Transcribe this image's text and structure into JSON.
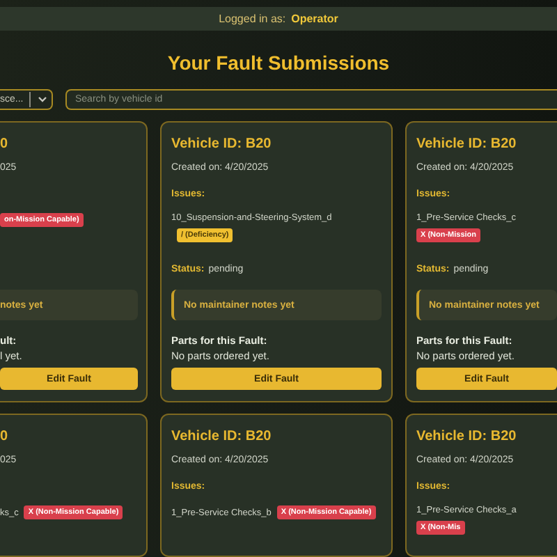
{
  "header": {
    "label": "Logged in as:",
    "user": "Operator"
  },
  "title": "Your Fault Submissions",
  "filter": {
    "value": "sce..."
  },
  "search": {
    "placeholder": "Search by vehicle id"
  },
  "cards": [
    {
      "kind": "cut-left",
      "title": "0",
      "created": "025",
      "issues": [
        {
          "badge": {
            "text": "on-Mission Capable)",
            "kind": "nmc"
          }
        }
      ],
      "notes": "notes yet",
      "parts_label": "ult:",
      "parts": "l yet.",
      "button": "Edit Fault"
    },
    {
      "kind": "whole",
      "title": "Vehicle ID: B20",
      "created": "Created on: 4/20/2025",
      "issues_label": "Issues:",
      "issues": [
        {
          "text": "10_Suspension-and-Steering-System_d",
          "badge": {
            "text": "/ (Deficiency)",
            "kind": "deficiency"
          }
        }
      ],
      "status_label": "Status:",
      "status": "pending",
      "notes": "No maintainer notes yet",
      "parts_label": "Parts for this Fault:",
      "parts": "No parts ordered yet.",
      "button": "Edit Fault"
    },
    {
      "kind": "cut-right",
      "title": "Vehicle ID: B20",
      "created": "Created on: 4/20/2025",
      "issues_label": "Issues:",
      "issues": [
        {
          "text": "1_Pre-Service Checks_c",
          "badge": {
            "text": "X (Non-Mission",
            "kind": "nmc"
          }
        }
      ],
      "status_label": "Status:",
      "status": "pending",
      "notes": "No maintainer notes yet",
      "parts_label": "Parts for this Fault:",
      "parts": "No parts ordered yet.",
      "button": "Edit Fault"
    },
    {
      "kind": "cut-left",
      "title": "0",
      "created": "025",
      "issues": [
        {
          "text": "ks_c",
          "badge": {
            "text": "X (Non-Mission Capable)",
            "kind": "nmc"
          }
        }
      ]
    },
    {
      "kind": "whole",
      "title": "Vehicle ID: B20",
      "created": "Created on: 4/20/2025",
      "issues_label": "Issues:",
      "issues": [
        {
          "text": "1_Pre-Service Checks_b",
          "badge": {
            "text": "X (Non-Mission Capable)",
            "kind": "nmc"
          }
        }
      ]
    },
    {
      "kind": "cut-right",
      "title": "Vehicle ID: B20",
      "created": "Created on: 4/20/2025",
      "issues_label": "Issues:",
      "issues": [
        {
          "text": "1_Pre-Service Checks_a",
          "badge": {
            "text": "X (Non-Mis",
            "kind": "nmc"
          }
        }
      ]
    }
  ]
}
